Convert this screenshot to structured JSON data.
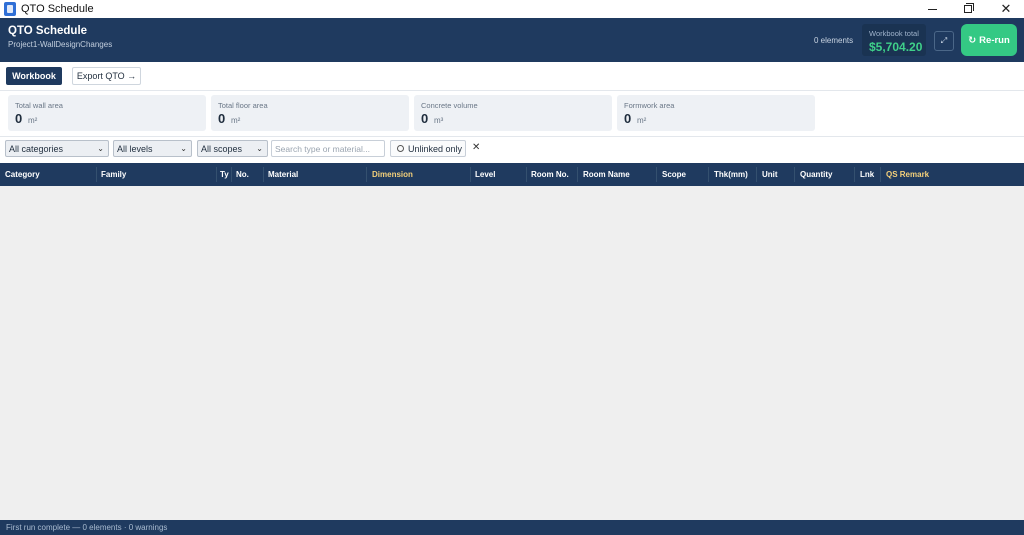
{
  "window": {
    "title": "QTO Schedule"
  },
  "header": {
    "title": "QTO Schedule",
    "subtitle": "Project1-WallDesignChanges",
    "element_count": "0 elements",
    "workbook_total_label": "Workbook total",
    "workbook_total_value": "$5,704.20",
    "expand_icon": "⤢",
    "rerun_label": "Re-run",
    "rerun_icon": "↻"
  },
  "tabs": {
    "workbook": "Workbook",
    "export": "Export QTO →"
  },
  "stats": [
    {
      "label": "Total wall area",
      "value": "0",
      "unit": "m²"
    },
    {
      "label": "Total floor area",
      "value": "0",
      "unit": "m²"
    },
    {
      "label": "Concrete volume",
      "value": "0",
      "unit": "m³"
    },
    {
      "label": "Formwork area",
      "value": "0",
      "unit": "m²"
    }
  ],
  "filters": {
    "category": "All categories",
    "level": "All levels",
    "scope": "All scopes",
    "search_placeholder": "Search type or material...",
    "unlinked_label": "Unlinked only",
    "clear_icon": "✕"
  },
  "table": {
    "columns": [
      "Category",
      "Family",
      "Ty",
      "No.",
      "Material",
      "Dimension",
      "Level",
      "Room No.",
      "Room Name",
      "Scope",
      "Thk(mm)",
      "Unit",
      "Quantity",
      "Lnk",
      "QS Remark"
    ]
  },
  "status": {
    "text": "First run complete — 0 elements · 0 warnings"
  },
  "colors": {
    "navy": "#1f3a5f",
    "green": "#34c984",
    "accent_gold": "#f4d07a"
  }
}
